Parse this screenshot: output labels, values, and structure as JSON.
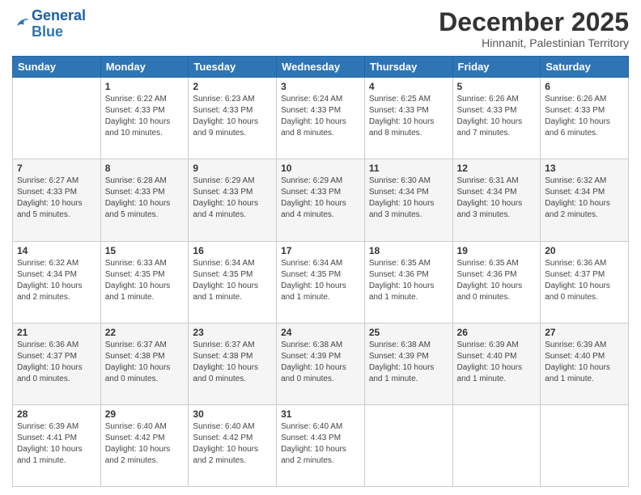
{
  "logo": {
    "text_general": "General",
    "text_blue": "Blue"
  },
  "header": {
    "title": "December 2025",
    "subtitle": "Hinnanit, Palestinian Territory"
  },
  "days_of_week": [
    "Sunday",
    "Monday",
    "Tuesday",
    "Wednesday",
    "Thursday",
    "Friday",
    "Saturday"
  ],
  "weeks": [
    [
      {
        "day": "",
        "info": ""
      },
      {
        "day": "1",
        "info": "Sunrise: 6:22 AM\nSunset: 4:33 PM\nDaylight: 10 hours and 10 minutes."
      },
      {
        "day": "2",
        "info": "Sunrise: 6:23 AM\nSunset: 4:33 PM\nDaylight: 10 hours and 9 minutes."
      },
      {
        "day": "3",
        "info": "Sunrise: 6:24 AM\nSunset: 4:33 PM\nDaylight: 10 hours and 8 minutes."
      },
      {
        "day": "4",
        "info": "Sunrise: 6:25 AM\nSunset: 4:33 PM\nDaylight: 10 hours and 8 minutes."
      },
      {
        "day": "5",
        "info": "Sunrise: 6:26 AM\nSunset: 4:33 PM\nDaylight: 10 hours and 7 minutes."
      },
      {
        "day": "6",
        "info": "Sunrise: 6:26 AM\nSunset: 4:33 PM\nDaylight: 10 hours and 6 minutes."
      }
    ],
    [
      {
        "day": "7",
        "info": "Sunrise: 6:27 AM\nSunset: 4:33 PM\nDaylight: 10 hours and 5 minutes."
      },
      {
        "day": "8",
        "info": "Sunrise: 6:28 AM\nSunset: 4:33 PM\nDaylight: 10 hours and 5 minutes."
      },
      {
        "day": "9",
        "info": "Sunrise: 6:29 AM\nSunset: 4:33 PM\nDaylight: 10 hours and 4 minutes."
      },
      {
        "day": "10",
        "info": "Sunrise: 6:29 AM\nSunset: 4:33 PM\nDaylight: 10 hours and 4 minutes."
      },
      {
        "day": "11",
        "info": "Sunrise: 6:30 AM\nSunset: 4:34 PM\nDaylight: 10 hours and 3 minutes."
      },
      {
        "day": "12",
        "info": "Sunrise: 6:31 AM\nSunset: 4:34 PM\nDaylight: 10 hours and 3 minutes."
      },
      {
        "day": "13",
        "info": "Sunrise: 6:32 AM\nSunset: 4:34 PM\nDaylight: 10 hours and 2 minutes."
      }
    ],
    [
      {
        "day": "14",
        "info": "Sunrise: 6:32 AM\nSunset: 4:34 PM\nDaylight: 10 hours and 2 minutes."
      },
      {
        "day": "15",
        "info": "Sunrise: 6:33 AM\nSunset: 4:35 PM\nDaylight: 10 hours and 1 minute."
      },
      {
        "day": "16",
        "info": "Sunrise: 6:34 AM\nSunset: 4:35 PM\nDaylight: 10 hours and 1 minute."
      },
      {
        "day": "17",
        "info": "Sunrise: 6:34 AM\nSunset: 4:35 PM\nDaylight: 10 hours and 1 minute."
      },
      {
        "day": "18",
        "info": "Sunrise: 6:35 AM\nSunset: 4:36 PM\nDaylight: 10 hours and 1 minute."
      },
      {
        "day": "19",
        "info": "Sunrise: 6:35 AM\nSunset: 4:36 PM\nDaylight: 10 hours and 0 minutes."
      },
      {
        "day": "20",
        "info": "Sunrise: 6:36 AM\nSunset: 4:37 PM\nDaylight: 10 hours and 0 minutes."
      }
    ],
    [
      {
        "day": "21",
        "info": "Sunrise: 6:36 AM\nSunset: 4:37 PM\nDaylight: 10 hours and 0 minutes."
      },
      {
        "day": "22",
        "info": "Sunrise: 6:37 AM\nSunset: 4:38 PM\nDaylight: 10 hours and 0 minutes."
      },
      {
        "day": "23",
        "info": "Sunrise: 6:37 AM\nSunset: 4:38 PM\nDaylight: 10 hours and 0 minutes."
      },
      {
        "day": "24",
        "info": "Sunrise: 6:38 AM\nSunset: 4:39 PM\nDaylight: 10 hours and 0 minutes."
      },
      {
        "day": "25",
        "info": "Sunrise: 6:38 AM\nSunset: 4:39 PM\nDaylight: 10 hours and 1 minute."
      },
      {
        "day": "26",
        "info": "Sunrise: 6:39 AM\nSunset: 4:40 PM\nDaylight: 10 hours and 1 minute."
      },
      {
        "day": "27",
        "info": "Sunrise: 6:39 AM\nSunset: 4:40 PM\nDaylight: 10 hours and 1 minute."
      }
    ],
    [
      {
        "day": "28",
        "info": "Sunrise: 6:39 AM\nSunset: 4:41 PM\nDaylight: 10 hours and 1 minute."
      },
      {
        "day": "29",
        "info": "Sunrise: 6:40 AM\nSunset: 4:42 PM\nDaylight: 10 hours and 2 minutes."
      },
      {
        "day": "30",
        "info": "Sunrise: 6:40 AM\nSunset: 4:42 PM\nDaylight: 10 hours and 2 minutes."
      },
      {
        "day": "31",
        "info": "Sunrise: 6:40 AM\nSunset: 4:43 PM\nDaylight: 10 hours and 2 minutes."
      },
      {
        "day": "",
        "info": ""
      },
      {
        "day": "",
        "info": ""
      },
      {
        "day": "",
        "info": ""
      }
    ]
  ]
}
